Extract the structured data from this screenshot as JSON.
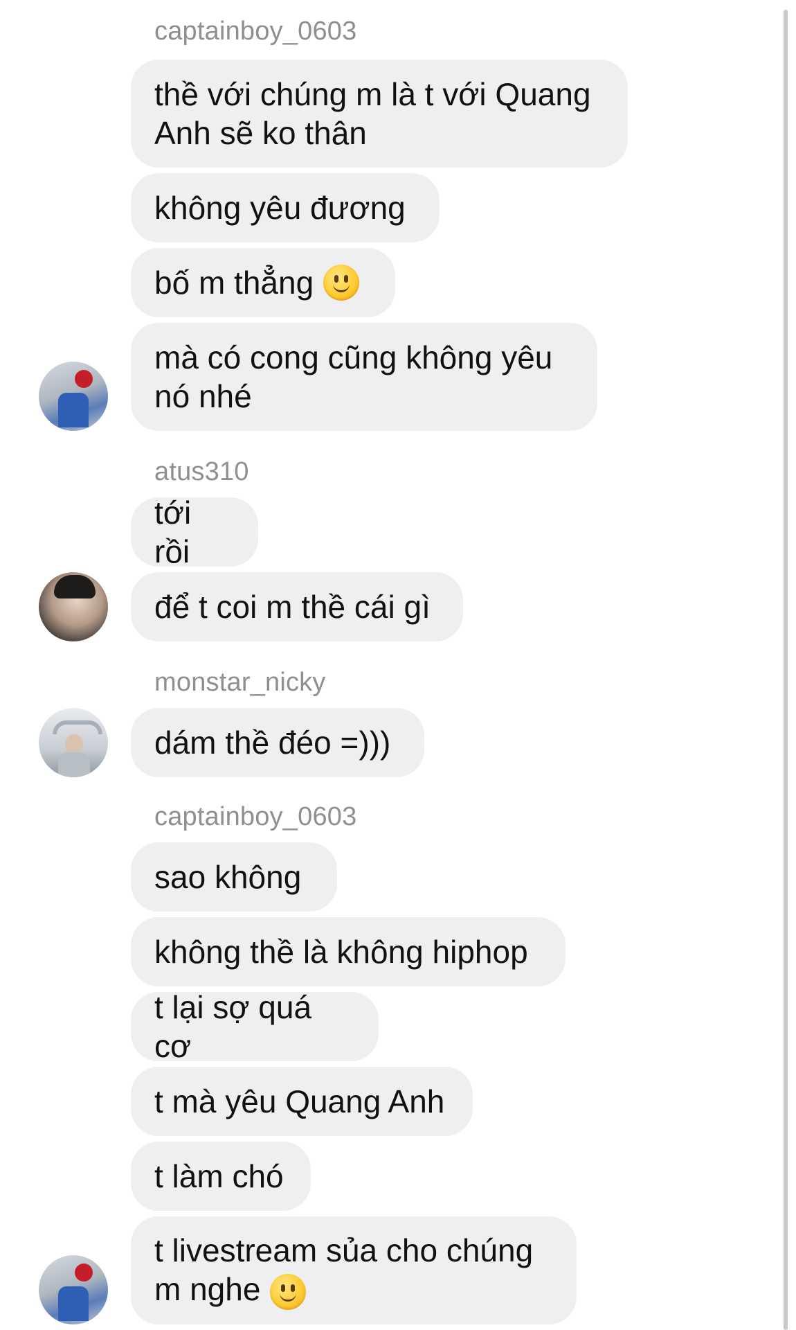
{
  "chat": {
    "groups": [
      {
        "username": "captainboy_0603",
        "messages": [
          "thề với chúng m là t với Quang Anh sẽ ko thân",
          "không yêu đương",
          "bố m thẳng",
          "mà có cong cũng không yêu nó nhé"
        ]
      },
      {
        "username": "atus310",
        "messages": [
          "tới rồi",
          "để t coi m thề cái gì"
        ]
      },
      {
        "username": "monstar_nicky",
        "messages": [
          "dám thề đéo =)))"
        ]
      },
      {
        "username": "captainboy_0603",
        "messages": [
          "sao không",
          "không thề là không hiphop",
          "t lại sợ quá cơ",
          "t mà yêu Quang Anh",
          "t làm chó",
          "t livestream sủa cho chúng m nghe"
        ]
      }
    ]
  },
  "icons": {
    "emoji": "slightly-smiling-face-icon"
  },
  "colors": {
    "bubble_bg": "#efeff1",
    "username_text": "#8e8e93",
    "message_text": "#111111",
    "scrollbar": "#c7c7cc"
  }
}
